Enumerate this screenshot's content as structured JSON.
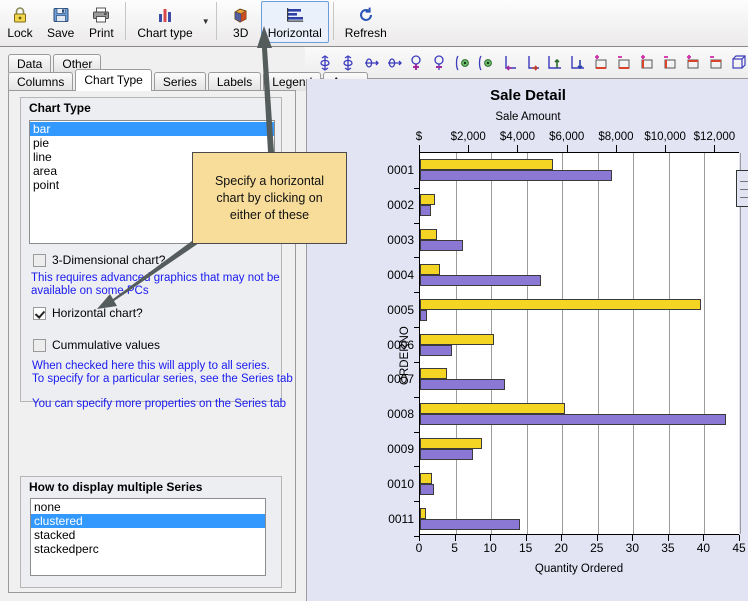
{
  "toolbar": {
    "buttons": [
      {
        "label": "Lock",
        "icon": "lock-icon"
      },
      {
        "label": "Save",
        "icon": "floppy-disk-icon"
      },
      {
        "label": "Print",
        "icon": "printer-icon"
      },
      {
        "label": "Chart type",
        "icon": "bar-chart-icon"
      },
      {
        "label": "3D",
        "icon": "cube-3d-icon"
      },
      {
        "label": "Horizontal",
        "icon": "horizontal-bars-icon"
      },
      {
        "label": "Refresh",
        "icon": "refresh-icon"
      }
    ],
    "selected": "Horizontal"
  },
  "tabs_row1": [
    "Data",
    "Other"
  ],
  "tabs_row2": [
    "Columns",
    "Chart Type",
    "Series",
    "Labels",
    "Legend",
    "Axes"
  ],
  "active_tab": "Chart Type",
  "chart_type_group": {
    "title": "Chart  Type",
    "options": [
      "bar",
      "pie",
      "line",
      "area",
      "point"
    ],
    "selected": "bar"
  },
  "checkboxes": [
    {
      "label": "3-Dimensional chart?",
      "checked": false
    },
    {
      "label": "Horizontal chart?",
      "checked": true
    },
    {
      "label": "Cummulative values",
      "checked": false
    }
  ],
  "hints": [
    "This requires advanced graphics that may not be",
    "available on some PCs",
    "When checked here this will apply to all series.",
    "To specify for a particular series, see the Series tab",
    "You can specify more properties on the Series tab"
  ],
  "series_group": {
    "title": "How to display multiple Series",
    "options": [
      "none",
      "clustered",
      "stacked",
      "stackedperc"
    ],
    "selected": "clustered"
  },
  "callout": {
    "text": "Specify a horizontal chart by clicking on either of these"
  },
  "colors": {
    "series0": "#f5d524",
    "series1": "#8a78d4",
    "selection": "#3399ff",
    "hint_text": "#1a1af0",
    "callout_bg": "#f8dd9a",
    "pane_bg": "#e2e4f4"
  },
  "chart_data": {
    "type": "bar",
    "orientation": "horizontal",
    "title": "Sale Detail",
    "subtitle": "Sale Amount",
    "categories": [
      "0001",
      "0002",
      "0003",
      "0004",
      "0005",
      "0006",
      "0007",
      "0008",
      "0009",
      "0010",
      "0011"
    ],
    "ylabel": "ORDERNO",
    "xlabel": "Quantity Ordered",
    "top_axis": {
      "label": "Sale Amount",
      "ticks": [
        "$",
        "$2,000",
        "$4,000",
        "$6,000",
        "$8,000",
        "$10,000",
        "$12,000"
      ],
      "values": [
        0,
        2000,
        4000,
        6000,
        8000,
        10000,
        12000
      ],
      "range": [
        0,
        13000
      ]
    },
    "bottom_axis": {
      "label": "Quantity Ordered",
      "ticks": [
        "0",
        "5",
        "10",
        "15",
        "20",
        "25",
        "30",
        "35",
        "40",
        "45"
      ],
      "values": [
        0,
        5,
        10,
        15,
        20,
        25,
        30,
        35,
        40,
        45
      ],
      "range": [
        0,
        45
      ]
    },
    "grid": true,
    "legend_position": "right",
    "series": [
      {
        "name": "Sale Amount",
        "axis": "top",
        "color": "#f5d524",
        "values": [
          5400,
          600,
          700,
          800,
          11400,
          3000,
          1100,
          5900,
          2500,
          500,
          250
        ]
      },
      {
        "name": "Quantity Ordered",
        "axis": "bottom",
        "color": "#8a78d4",
        "values": [
          27,
          1.5,
          6,
          17,
          1,
          4.5,
          12,
          43,
          7.5,
          2,
          14
        ]
      }
    ]
  }
}
